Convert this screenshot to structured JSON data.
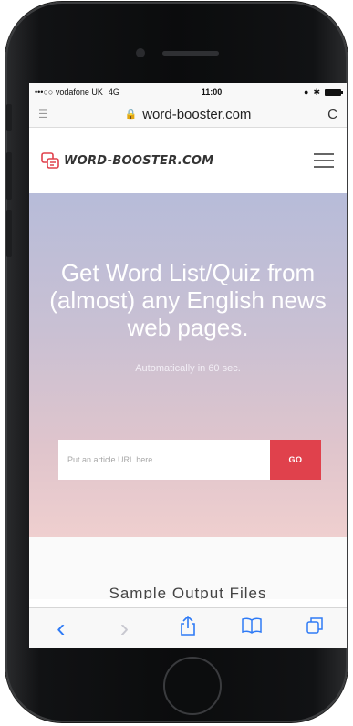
{
  "status": {
    "carrier": "•••○○ vodafone UK",
    "network": "4G",
    "time": "11:00"
  },
  "browser": {
    "url": "word-booster.com",
    "reload_icon": "reload-icon",
    "reader_icon": "reader-icon"
  },
  "site": {
    "logo_text": "WORD-BOOSTER.COM",
    "menu_icon": "hamburger-menu-icon"
  },
  "hero": {
    "title": "Get Word List/Quiz from (almost) any English news web pages.",
    "subtitle": "Automatically in 60 sec.",
    "input_placeholder": "Put an article URL here",
    "go_label": "GO"
  },
  "sample": {
    "title": "Sample Output Files"
  },
  "toolbar": {
    "back": "‹",
    "forward": "›"
  },
  "colors": {
    "accent": "#e0414c",
    "ios_blue": "#2f7bf6"
  }
}
